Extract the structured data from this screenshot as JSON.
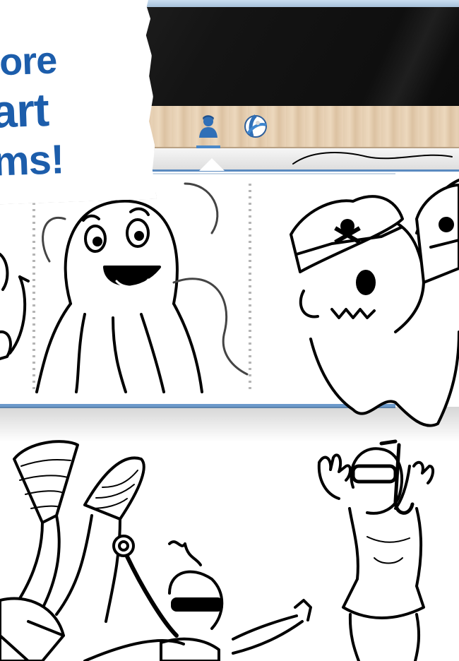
{
  "promo": {
    "line1": "ore",
    "line2": "art",
    "line3": "ms!"
  },
  "toolbar": {
    "items": [
      {
        "icon": "character-icon",
        "active": true
      },
      {
        "icon": "beach-ball-icon",
        "active": false
      }
    ]
  },
  "colors": {
    "accent": "#1c5dab",
    "frame_border": "#6c9acb",
    "wood": "#e4cdb0",
    "screen": "#141414"
  }
}
